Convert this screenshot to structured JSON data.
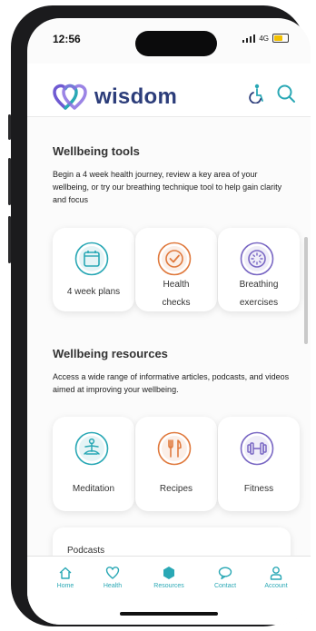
{
  "status": {
    "time": "12:56",
    "network": "4G"
  },
  "app": {
    "name": "wisdom"
  },
  "colors": {
    "brand": "#2c3d7a",
    "teal": "#2aa8b5",
    "orange": "#e07a3e",
    "purple": "#7a68c4"
  },
  "tools": {
    "title": "Wellbeing tools",
    "description": "Begin a 4 week health journey, review a key area of your wellbeing, or try our breathing technique tool to help gain clarity and focus",
    "cards": [
      {
        "label": "4 week plans",
        "icon": "calendar-icon"
      },
      {
        "label_line1": "Health",
        "label_line2": "checks",
        "icon": "check-icon"
      },
      {
        "label_line1": "Breathing",
        "label_line2": "exercises",
        "icon": "breathing-icon"
      }
    ]
  },
  "resources": {
    "title": "Wellbeing resources",
    "description": "Access a wide range of informative articles, podcasts, and videos aimed at improving your wellbeing.",
    "cards": [
      {
        "label": "Meditation",
        "icon": "meditation-icon"
      },
      {
        "label": "Recipes",
        "icon": "cutlery-icon"
      },
      {
        "label": "Fitness",
        "icon": "dumbbell-icon"
      }
    ]
  },
  "podcasts": {
    "label": "Podcasts"
  },
  "tabbar": {
    "items": [
      {
        "label": "Home",
        "icon": "home-icon"
      },
      {
        "label": "Health",
        "icon": "heart-icon"
      },
      {
        "label": "Resources",
        "icon": "hexagon-icon",
        "active": true
      },
      {
        "label": "Contact",
        "icon": "chat-icon"
      },
      {
        "label": "Account",
        "icon": "user-icon"
      }
    ]
  }
}
